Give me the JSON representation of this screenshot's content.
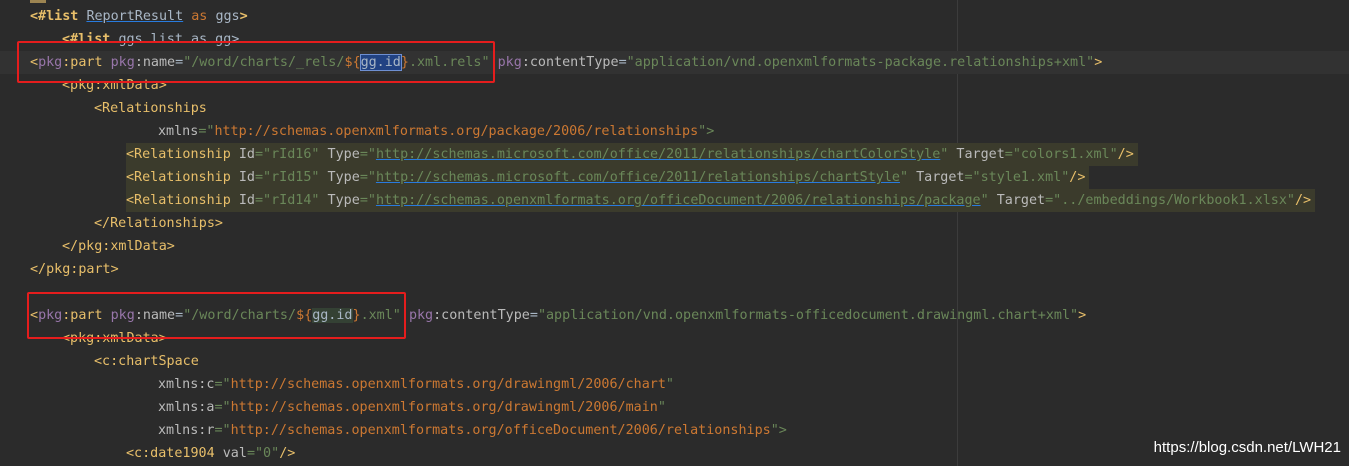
{
  "lines": {
    "l1": {
      "kw": "<#list",
      "v1": "ReportResult",
      "as": "as",
      "v2": "ggs",
      "end": ">"
    },
    "l2": {
      "kw": "<#list",
      "rest": "ggs.list as gg>"
    },
    "l3": {
      "open": "<",
      "ns": "pkg",
      "tag": ":part",
      "a1ns": "pkg",
      "a1": ":name",
      "eq": "=",
      "v_pre": "\"/word/charts/_rels/",
      "dollar": "${",
      "var": "gg.id",
      "close": "}",
      "v_post": ".xml.rels\"",
      "a2ns": "pkg",
      "a2": ":contentType",
      "v2": "\"application/vnd.openxmlformats-package.relationships+xml\"",
      "end": ">"
    },
    "l4": {
      "text": "<pkg:xmlData>"
    },
    "l5": {
      "text": "<Relationships"
    },
    "l6": {
      "attr": "xmlns",
      "eq": "=\"",
      "url": "http://schemas.openxmlformats.org/package/2006/relationships",
      "end": "\">"
    },
    "l7": {
      "tag": "<Relationship",
      "id_a": " Id",
      "id_v": "=\"rId16\"",
      "type_a": " Type",
      "eq": "=\"",
      "url": "http://schemas.microsoft.com/office/2011/relationships/chartColorStyle",
      "q": "\"",
      "tgt_a": " Target",
      "tgt_v": "=\"colors1.xml\"",
      "end": "/>"
    },
    "l8": {
      "tag": "<Relationship",
      "id_a": " Id",
      "id_v": "=\"rId15\"",
      "type_a": " Type",
      "eq": "=\"",
      "url": "http://schemas.microsoft.com/office/2011/relationships/chartStyle",
      "q": "\"",
      "tgt_a": " Target",
      "tgt_v": "=\"style1.xml\"",
      "end": "/>"
    },
    "l9": {
      "tag": "<Relationship",
      "id_a": " Id",
      "id_v": "=\"rId14\"",
      "type_a": " Type",
      "eq": "=\"",
      "url": "http://schemas.openxmlformats.org/officeDocument/2006/relationships/package",
      "q": "\"",
      "tgt_a": " Target",
      "tgt_v": "=\"../embeddings/Workbook1.xlsx\"",
      "end": "/>"
    },
    "l10": {
      "text": "</Relationships>"
    },
    "l11": {
      "text": "</pkg:xmlData>"
    },
    "l12": {
      "text": "</pkg:part>"
    },
    "l14": {
      "open": "<",
      "ns": "pkg",
      "tag": ":part",
      "a1ns": "pkg",
      "a1": ":name",
      "eq": "=",
      "v_pre": "\"/word/charts/",
      "dollar": "${",
      "var": "gg.id",
      "close": "}",
      "v_post": ".xml\"",
      "a2ns": "pkg",
      "a2": ":contentType",
      "v2": "\"application/vnd.openxmlformats-officedocument.drawingml.chart+xml\"",
      "end": ">"
    },
    "l15": {
      "text": "<pkg:xmlData>"
    },
    "l16": {
      "text": "<c:chartSpace"
    },
    "l17": {
      "attr": "xmlns:c",
      "eq": "=\"",
      "url": "http://schemas.openxmlformats.org/drawingml/2006/chart",
      "end": "\""
    },
    "l18": {
      "attr": "xmlns:a",
      "eq": "=\"",
      "url": "http://schemas.openxmlformats.org/drawingml/2006/main",
      "end": "\""
    },
    "l19": {
      "attr": "xmlns:r",
      "eq": "=\"",
      "url": "http://schemas.openxmlformats.org/officeDocument/2006/relationships",
      "end": "\">"
    },
    "l20": {
      "tag": "<c:date1904",
      "attr": " val",
      "val": "=\"0\"",
      "end": "/>"
    }
  },
  "watermark": "https://blog.csdn.net/LWH21",
  "colors": {
    "highlight_box": "#e51d1d",
    "background": "#2b2b2b"
  }
}
